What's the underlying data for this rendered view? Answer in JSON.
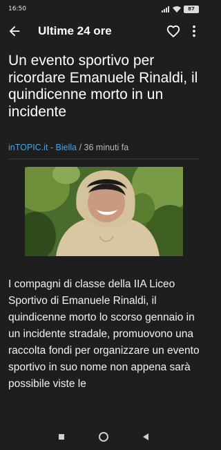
{
  "status_bar": {
    "time": "16:50",
    "battery_level": "87",
    "icons": [
      "signal-icon",
      "wifi-icon",
      "battery-icon"
    ]
  },
  "app_bar": {
    "title": "Ultime 24 ore",
    "icons": [
      "back-arrow-icon",
      "heart-outline-icon",
      "more-vertical-icon"
    ]
  },
  "article": {
    "headline": "Un evento sportivo per ricordare Emanuele Rinaldi, il quindicenne morto in un incidente",
    "source": "inTOPIC.it - Biella",
    "time_separator": " / ",
    "time_ago": "36 minuti fa",
    "body": "I compagni di classe della IIA Liceo Sportivo di Emanuele Rinaldi, il quindicenne morto lo scorso gennaio in un incidente stradale, promuovono una raccolta fondi per organizzare un evento sportivo in suo nome non appena sarà possibile viste le"
  },
  "colors": {
    "background": "#1e1e1e",
    "link": "#4aa3e0",
    "meta": "#b8b8b8"
  },
  "nav_bar": {
    "icons": [
      "recents-square-icon",
      "home-circle-icon",
      "back-triangle-icon"
    ]
  }
}
